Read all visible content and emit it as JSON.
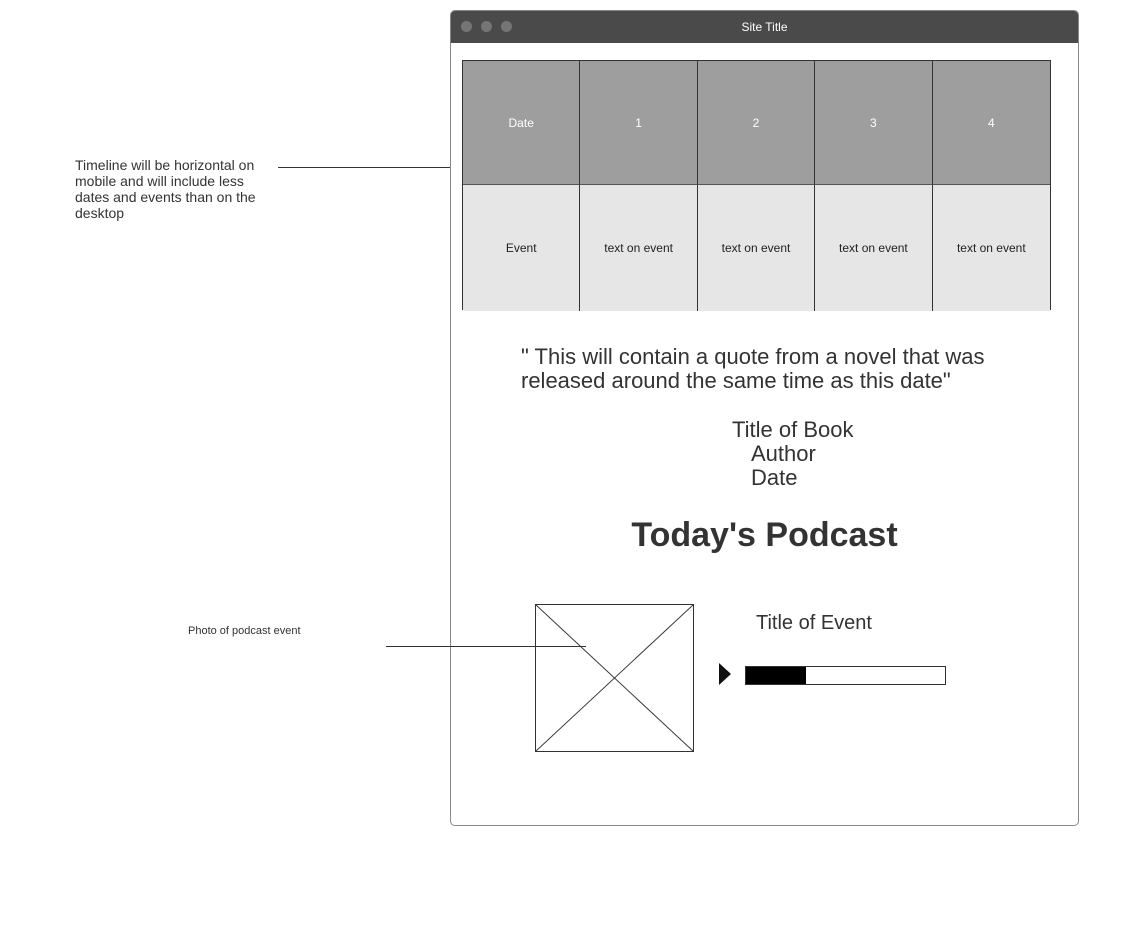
{
  "annotations": {
    "timeline_note": "Timeline will be horizontal on mobile and will include less dates and events than on the desktop",
    "photo_note": "Photo of podcast event"
  },
  "window": {
    "title": "Site Title"
  },
  "timeline": {
    "headers": [
      "Date",
      "1",
      "2",
      "3",
      "4"
    ],
    "events": [
      "Event",
      "text on event",
      "text on event",
      "text on event",
      "text on event"
    ]
  },
  "quote": {
    "text": "\" This will contain a quote from a novel that was released around the same time as this date\"",
    "book_title": "Title of Book",
    "author": "Author",
    "date": "Date"
  },
  "podcast": {
    "heading": "Today's Podcast",
    "photo_icon": "image-placeholder-icon",
    "event_title": "Title of Event",
    "play_icon": "play-icon",
    "progress": 0.3
  }
}
